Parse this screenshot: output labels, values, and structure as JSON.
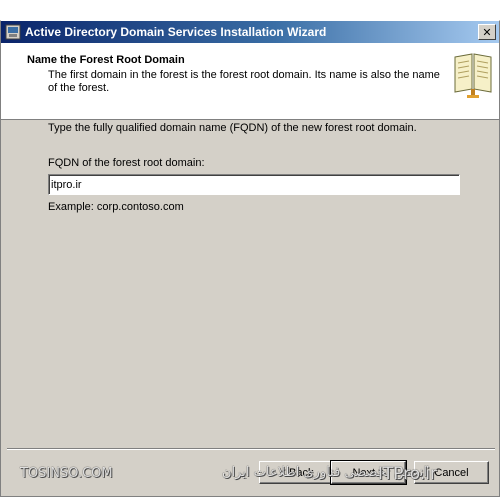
{
  "window": {
    "title": "Active Directory Domain Services Installation Wizard",
    "close_symbol": "✕"
  },
  "header": {
    "heading": "Name the Forest Root Domain",
    "description": "The first domain in the forest is the forest root domain. Its name is also the name of the forest."
  },
  "main": {
    "instruction": "Type the fully qualified domain name (FQDN) of the new forest root domain.",
    "fqdn_label": "FQDN of the forest root domain:",
    "fqdn_value": "itpro.ir",
    "example": "Example: corp.contoso.com"
  },
  "buttons": {
    "back": "< Back",
    "next": "Next >",
    "cancel": "Cancel"
  },
  "watermark": {
    "left": "TOSINSO.COM",
    "right": "انجمن تخصصی فناوری اطلاعات ایران",
    "brand": "ITPro.ir"
  }
}
